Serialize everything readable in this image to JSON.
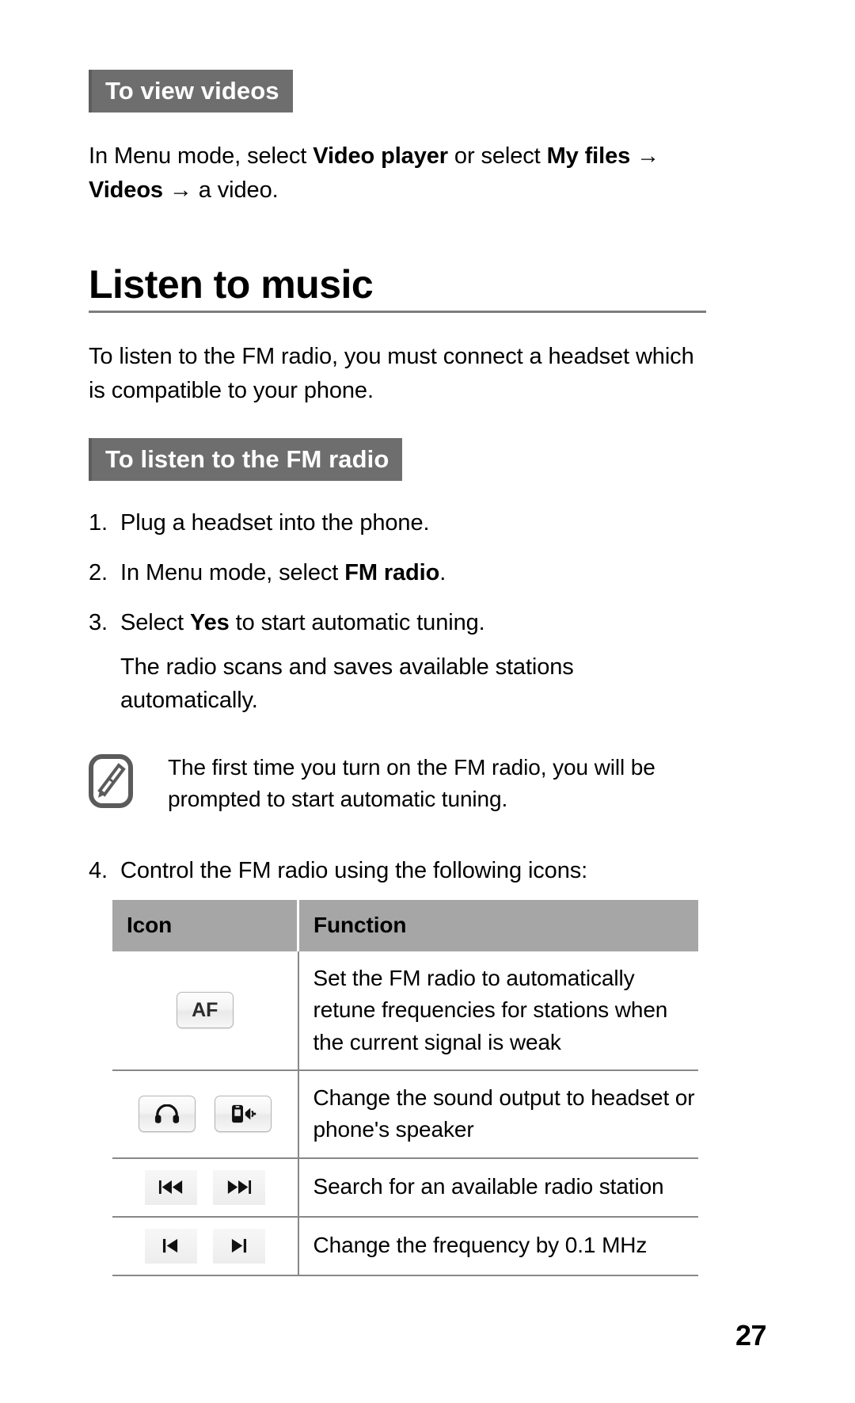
{
  "sections": {
    "view_videos": {
      "ribbon": "To view videos",
      "body_prefix": "In Menu mode, select ",
      "bold1": "Video player",
      "mid": " or select ",
      "bold2": "My files",
      "arrow1": " → ",
      "bold3": "Videos",
      "arrow2": " → ",
      "tail": "a video."
    },
    "chapter": {
      "title": "Listen to music",
      "intro": "To listen to the FM radio, you must connect a headset which is compatible to your phone."
    },
    "fm_radio": {
      "ribbon": "To listen to the FM radio",
      "steps": [
        {
          "num": "1.",
          "text": "Plug a headset into the phone."
        },
        {
          "num": "2.",
          "text_prefix": "In Menu mode, select ",
          "bold": "FM radio",
          "text_suffix": "."
        },
        {
          "num": "3.",
          "text_prefix": "Select ",
          "bold": "Yes",
          "text_suffix": " to start automatic tuning."
        }
      ],
      "step3_sub": "The radio scans and saves available stations automatically.",
      "note": "The first time you turn on the FM radio, you will be prompted to start automatic tuning.",
      "note_icon": "note-pencil-icon",
      "step4": {
        "num": "4.",
        "text": "Control the FM radio using the following icons:"
      }
    }
  },
  "table": {
    "headers": [
      "Icon",
      "Function"
    ],
    "rows": [
      {
        "icons": [
          {
            "type": "label",
            "label": "AF",
            "name": "af-button-icon"
          }
        ],
        "function": "Set the FM radio to automatically retune frequencies for stations when the current signal is weak"
      },
      {
        "icons": [
          {
            "type": "glyph",
            "label": "headphones",
            "name": "headphones-icon"
          },
          {
            "type": "glyph",
            "label": "phone-speaker",
            "name": "phone-speaker-icon"
          }
        ],
        "function": "Change the sound output to headset or phone's speaker"
      },
      {
        "icons": [
          {
            "type": "glyph",
            "label": "rewind",
            "name": "rewind-icon"
          },
          {
            "type": "glyph",
            "label": "fast-forward",
            "name": "fast-forward-icon"
          }
        ],
        "function": "Search for an available radio station"
      },
      {
        "icons": [
          {
            "type": "glyph",
            "label": "previous-track",
            "name": "previous-track-icon"
          },
          {
            "type": "glyph",
            "label": "next-track",
            "name": "next-track-icon"
          }
        ],
        "function": "Change the frequency by 0.1 MHz"
      }
    ]
  },
  "footer": {
    "page_number": "27"
  },
  "colors": {
    "ribbon_bg": "#6e6e6e",
    "table_header_bg": "#a6a6a6",
    "rule": "#7d7d7d",
    "text": "#000000"
  }
}
